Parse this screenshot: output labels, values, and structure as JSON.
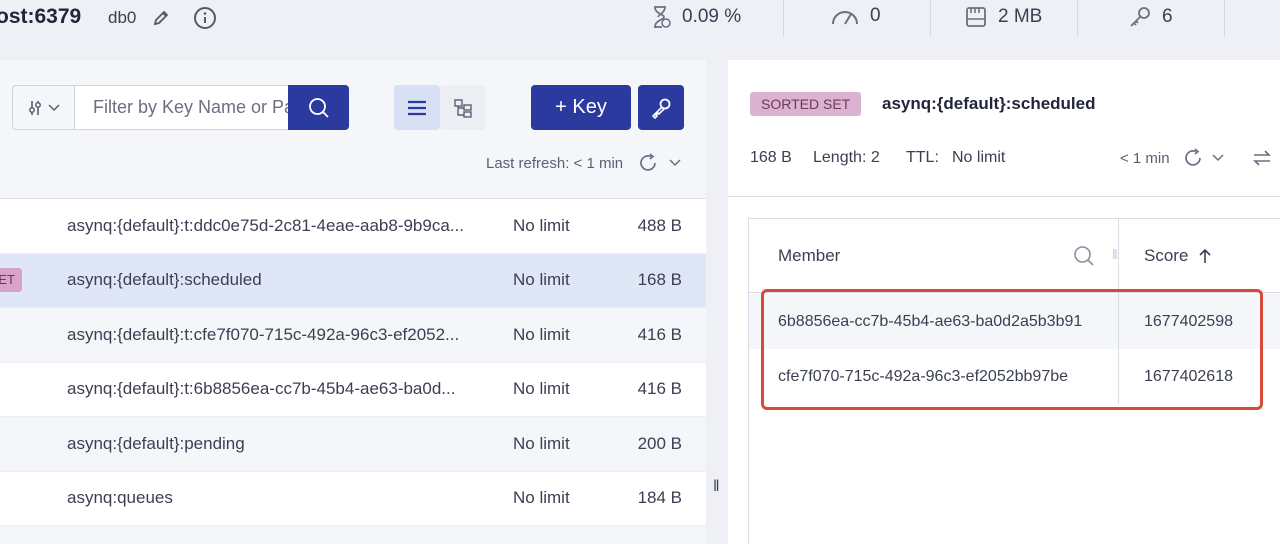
{
  "topbar": {
    "host": "ost:6379",
    "db": "db0",
    "stats": {
      "cpu": "0.09 %",
      "clients": "0",
      "memory": "2 MB",
      "keys": "6"
    }
  },
  "browser": {
    "filter_placeholder": "Filter by Key Name or Pattern",
    "add_key_label": "+ Key",
    "last_refresh": "Last refresh: < 1 min",
    "rows": [
      {
        "name": "asynq:{default}:t:ddc0e75d-2c81-4eae-aab8-9b9ca...",
        "ttl": "No limit",
        "size": "488 B"
      },
      {
        "name": "asynq:{default}:scheduled",
        "ttl": "No limit",
        "size": "168 B",
        "badge": "ET"
      },
      {
        "name": "asynq:{default}:t:cfe7f070-715c-492a-96c3-ef2052...",
        "ttl": "No limit",
        "size": "416 B"
      },
      {
        "name": "asynq:{default}:t:6b8856ea-cc7b-45b4-ae63-ba0d...",
        "ttl": "No limit",
        "size": "416 B"
      },
      {
        "name": "asynq:{default}:pending",
        "ttl": "No limit",
        "size": "200 B"
      },
      {
        "name": "asynq:queues",
        "ttl": "No limit",
        "size": "184 B"
      }
    ]
  },
  "details": {
    "type_badge": "SORTED SET",
    "key_name": "asynq:{default}:scheduled",
    "size": "168 B",
    "length": "Length: 2",
    "ttl_label": "TTL:",
    "ttl_value": "No limit",
    "refresh": "< 1 min",
    "columns": {
      "member": "Member",
      "score": "Score"
    },
    "members": [
      {
        "member": "6b8856ea-cc7b-45b4-ae63-ba0d2a5b3b91",
        "score": "1677402598"
      },
      {
        "member": "cfe7f070-715c-492a-96c3-ef2052bb97be",
        "score": "1677402618"
      }
    ]
  },
  "colors": {
    "primary": "#2b3a9e",
    "highlight": "#d8493a",
    "sorted_set_badge": "#dbb2cf"
  }
}
